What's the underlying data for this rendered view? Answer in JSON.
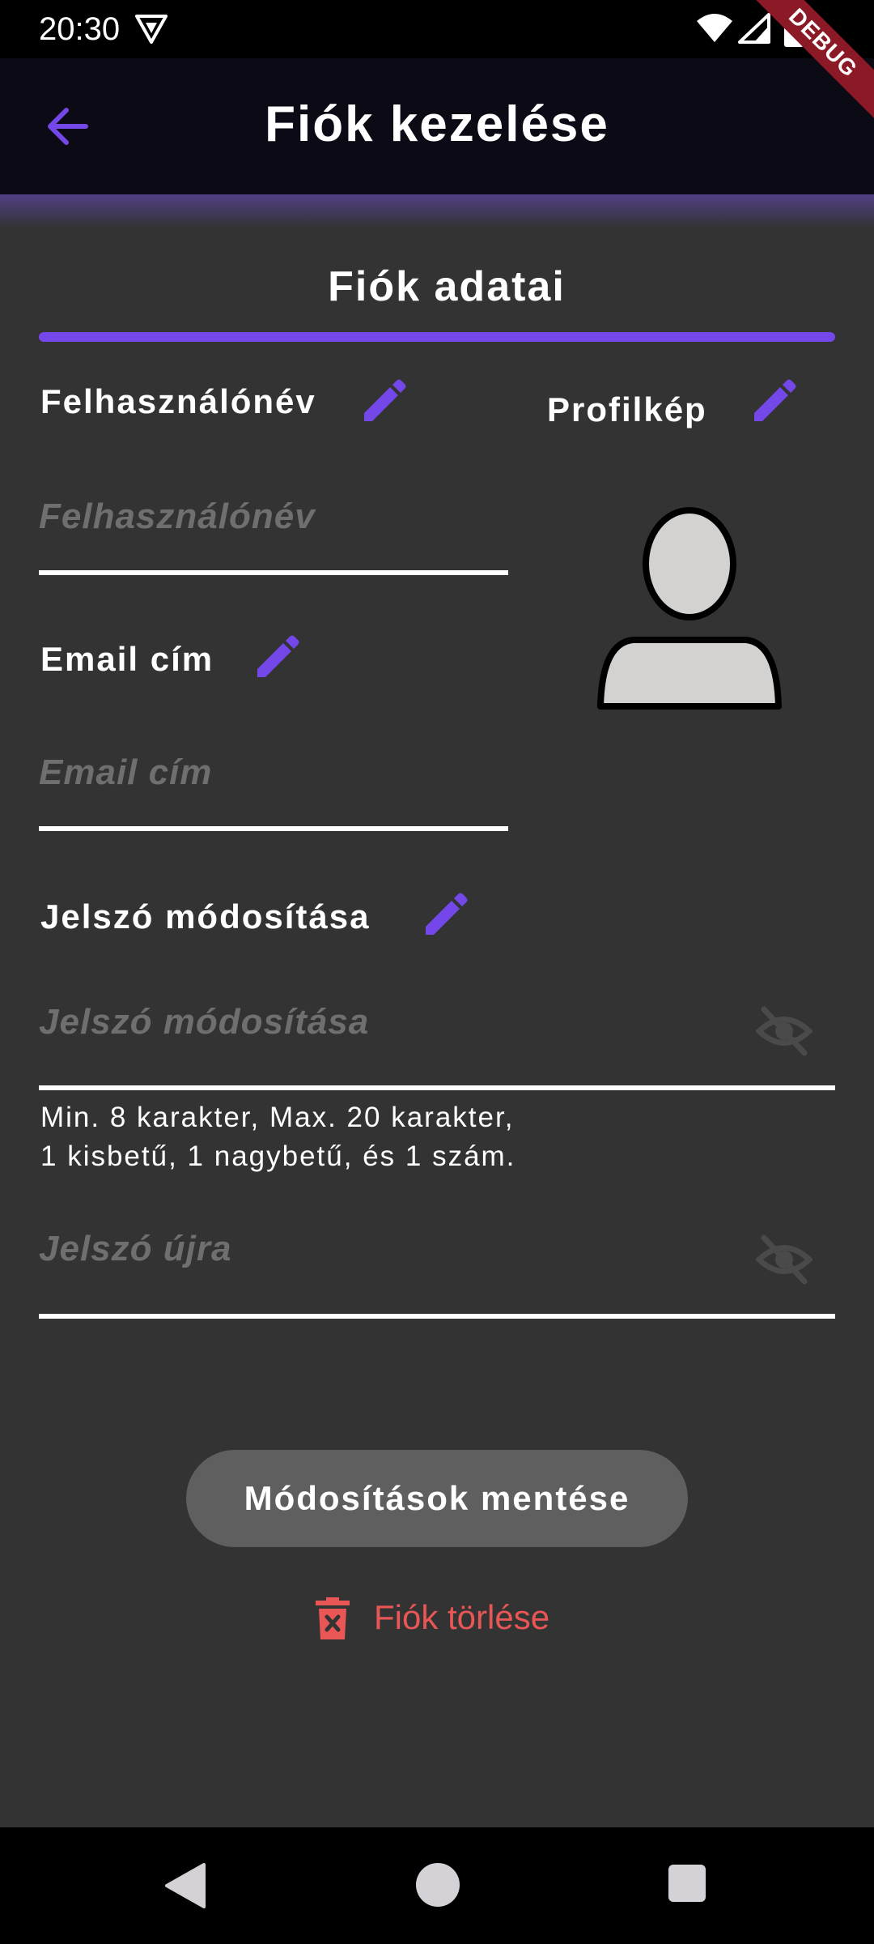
{
  "status_bar": {
    "time": "20:30",
    "debug_banner": "DEBUG"
  },
  "app_bar": {
    "title": "Fiók kezelése"
  },
  "section": {
    "title": "Fiók adatai"
  },
  "username": {
    "label": "Felhasználónév",
    "placeholder": "Felhasználónév"
  },
  "profile_picture": {
    "label": "Profilkép"
  },
  "email": {
    "label": "Email cím",
    "placeholder": "Email cím"
  },
  "password": {
    "label": "Jelszó módosítása",
    "placeholder": "Jelszó módosítása",
    "helper_line1": "Min. 8 karakter, Max. 20 karakter,",
    "helper_line2": "1 kisbetű, 1 nagybetű, és 1 szám."
  },
  "password_confirm": {
    "placeholder": "Jelszó újra"
  },
  "actions": {
    "save_label": "Módosítások mentése",
    "delete_label": "Fiók törlése"
  },
  "colors": {
    "accent": "#7447e8",
    "danger": "#e85656",
    "background": "#333333",
    "app_bar": "#0c0a14"
  },
  "icons": {
    "back": "arrow-back-icon",
    "edit": "pencil-icon",
    "visibility": "eye-off-icon",
    "delete": "trash-icon",
    "avatar": "person-placeholder-icon"
  }
}
